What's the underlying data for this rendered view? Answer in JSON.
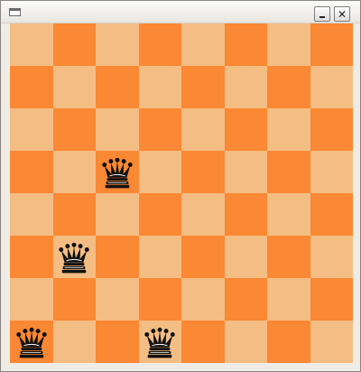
{
  "window": {
    "icons": {
      "system": "window-icon",
      "minimize": "minimize-icon",
      "close": "close-icon"
    },
    "close_glyph": "✕"
  },
  "board": {
    "rows": 8,
    "cols": 8,
    "colors": {
      "light": "#f4bd84",
      "dark": "#fb8834",
      "piece": "#111111"
    },
    "top_left_square": "light",
    "pieces": [
      {
        "type": "queen",
        "color": "black",
        "row": 3,
        "col": 2
      },
      {
        "type": "queen",
        "color": "black",
        "row": 5,
        "col": 1
      },
      {
        "type": "queen",
        "color": "black",
        "row": 7,
        "col": 0
      },
      {
        "type": "queen",
        "color": "black",
        "row": 7,
        "col": 3
      }
    ]
  }
}
